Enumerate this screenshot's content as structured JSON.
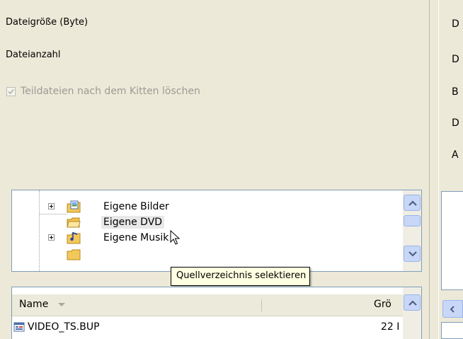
{
  "left_panel": {
    "file_size_label": "Dateigröße (Byte)",
    "file_count_label": "Dateianzahl",
    "delete_parts_checkbox": {
      "label": "Teildateien nach dem Kitten löschen",
      "checked": true,
      "disabled": true
    }
  },
  "folder_tree": {
    "items": [
      {
        "label": "Eigene Bilder",
        "expandable": true,
        "icon": "pictures-folder-icon"
      },
      {
        "label": "Eigene DVD",
        "expandable": false,
        "selected_hover": true,
        "icon": "folder-icon"
      },
      {
        "label": "Eigene Musik",
        "expandable": true,
        "icon": "music-folder-icon"
      }
    ]
  },
  "tooltip": {
    "text": "Quellverzeichnis selektieren"
  },
  "file_list": {
    "columns": [
      {
        "label": "Name",
        "sort": "descending"
      },
      {
        "label": "Grö"
      }
    ],
    "rows": [
      {
        "name": "VIDEO_TS.BUP",
        "size": "22 I"
      }
    ]
  },
  "right_panel": {
    "labels": [
      "D",
      "D",
      "B",
      "D",
      "A"
    ]
  },
  "colors": {
    "window_bg": "#ece9d8",
    "border_blue": "#7f9db9",
    "scroll_blue": "#c8d7f7",
    "tooltip_bg": "#ffffe1"
  }
}
